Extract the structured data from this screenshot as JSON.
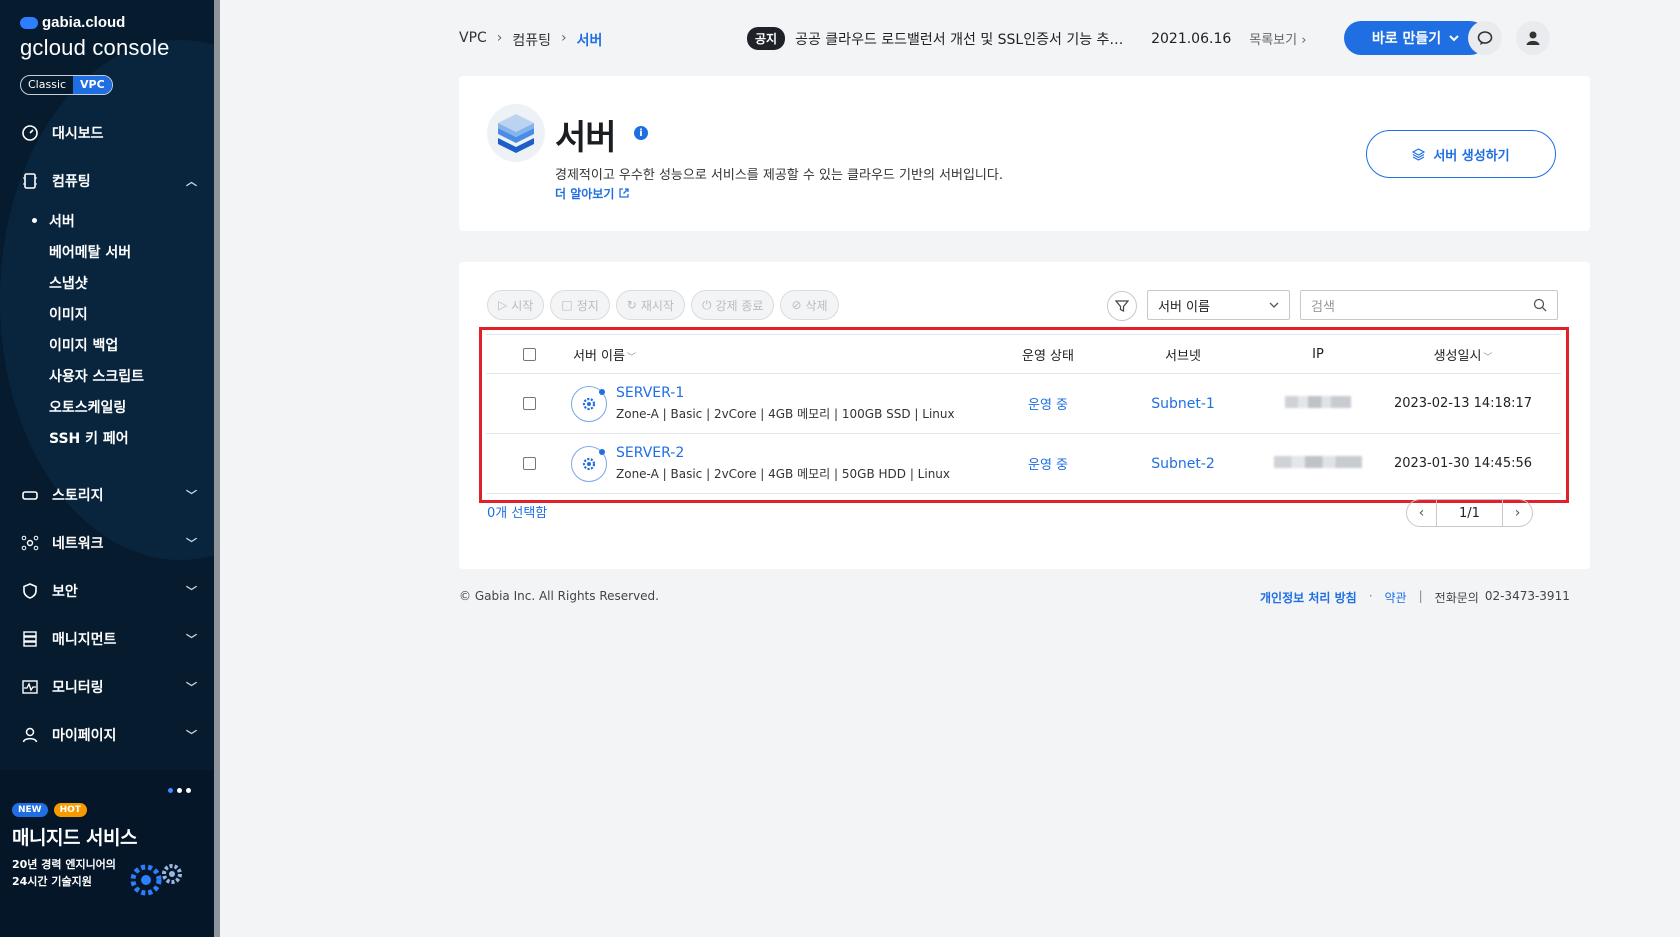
{
  "sidebar": {
    "brand_top": "gabia.cloud",
    "brand_main": "gcloud console",
    "toggle": {
      "classic": "Classic",
      "vpc": "VPC"
    },
    "dashboard": "대시보드",
    "computing": {
      "label": "컴퓨팅",
      "items": [
        "서버",
        "베어메탈 서버",
        "스냅샷",
        "이미지",
        "이미지 백업",
        "사용자 스크립트",
        "오토스케일링",
        "SSH 키 페어"
      ]
    },
    "sections": [
      "스토리지",
      "네트워크",
      "보안",
      "매니지먼트",
      "모니터링",
      "마이페이지"
    ],
    "promo": {
      "badge_new": "NEW",
      "badge_hot": "HOT",
      "title": "매니지드 서비스",
      "subtitle": "20년 경력 엔지니어의 24시간 기술지원"
    }
  },
  "topbar": {
    "breadcrumb": [
      "VPC",
      "컴퓨팅",
      "서버"
    ],
    "notice_tag": "공지",
    "notice_text": "공공 클라우드 로드밸런서 개선 및 SSL인증서 기능 추…",
    "notice_date": "2021.06.16",
    "notice_more": "목록보기",
    "quick_button": "바로 만들기"
  },
  "header": {
    "title": "서버",
    "description": "경제적이고 우수한 성능으로 서비스를 제공할 수 있는 클라우드 기반의 서버입니다.",
    "learn_more": "더 알아보기",
    "create_button": "서버 생성하기"
  },
  "toolbar": {
    "start": "시작",
    "stop": "정지",
    "restart": "재시작",
    "force_stop": "강제 종료",
    "delete": "삭제",
    "filter_select": "서버 이름",
    "search_placeholder": "검색"
  },
  "table": {
    "columns": {
      "name": "서버 이름",
      "state": "운영 상태",
      "subnet": "서브넷",
      "ip": "IP",
      "created": "생성일시"
    },
    "rows": [
      {
        "name": "SERVER-1",
        "spec": "Zone-A  |  Basic  |  2vCore  |  4GB 메모리  |  100GB SSD  |  Linux",
        "state": "운영 중",
        "subnet": "Subnet-1",
        "created": "2023-02-13 14:18:17"
      },
      {
        "name": "SERVER-2",
        "spec": "Zone-A  |  Basic  |  2vCore  |  4GB 메모리  |  50GB HDD  |  Linux",
        "state": "운영 중",
        "subnet": "Subnet-2",
        "created": "2023-01-30 14:45:56"
      }
    ],
    "selected_count": "0개 선택함",
    "page": "1/1"
  },
  "footer": {
    "copyright": "© Gabia Inc. All Rights Reserved.",
    "privacy": "개인정보 처리 방침",
    "terms": "약관",
    "phone_label": "전화문의",
    "phone": "02-3473-3911"
  },
  "colors": {
    "accent": "#1f6fe3",
    "sidebar_bg": "#061b2e",
    "highlight": "#e0202a"
  }
}
